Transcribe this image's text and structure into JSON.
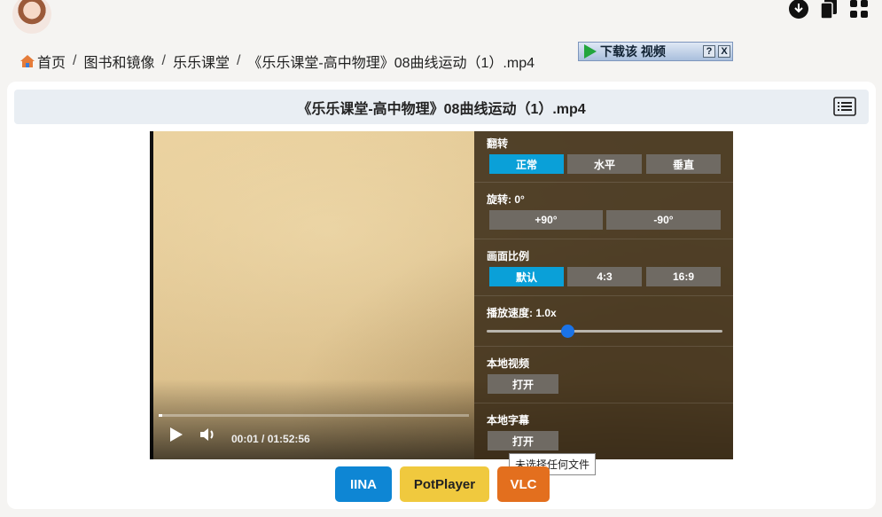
{
  "breadcrumb": {
    "home": "首页",
    "items": [
      "图书和镜像",
      "乐乐课堂",
      "《乐乐课堂-高中物理》08曲线运动（1）.mp4"
    ]
  },
  "header": {
    "title": "《乐乐课堂-高中物理》08曲线运动（1）.mp4"
  },
  "player": {
    "time": "00:01 / 01:52:56",
    "progress": 0.01,
    "settings": {
      "flip": {
        "label": "翻转",
        "options": [
          "正常",
          "水平",
          "垂直"
        ],
        "selected": "正常"
      },
      "rotate": {
        "label": "旋转: 0°",
        "options": [
          "+90°",
          "-90°"
        ]
      },
      "aspect": {
        "label": "画面比例",
        "options": [
          "默认",
          "4:3",
          "16:9"
        ],
        "selected": "默认"
      },
      "speed": {
        "label": "播放速度: 1.0x",
        "value": 1.0
      },
      "local_video": {
        "label": "本地视频",
        "button": "打开"
      },
      "local_subtitle": {
        "label": "本地字幕",
        "button": "打开"
      }
    }
  },
  "download_bar": {
    "label": "下载该 视频",
    "help": "?",
    "close": "X"
  },
  "tooltip": "未选择任何文件",
  "apps": [
    {
      "label": "IINA",
      "bg": "#0e86d4",
      "fg": "#ffffff"
    },
    {
      "label": "PotPlayer",
      "bg": "#f0c93e",
      "fg": "#222222"
    },
    {
      "label": "VLC",
      "bg": "#e36f1e",
      "fg": "#ffffff"
    }
  ],
  "colors": {
    "accent": "#0aa0d8",
    "header_bg": "#e9eef3"
  }
}
